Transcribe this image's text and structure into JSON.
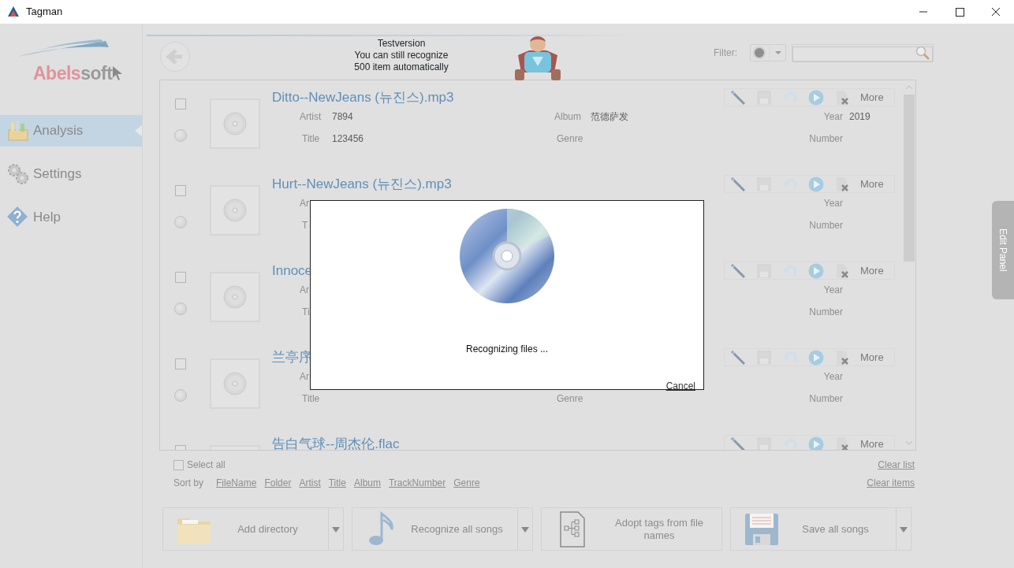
{
  "window": {
    "title": "Tagman"
  },
  "sidebar": {
    "logo": {
      "part_1": "Abels",
      "part_2": "soft"
    },
    "items": [
      {
        "label": "Analysis",
        "kind": "analysis",
        "selected": true
      },
      {
        "label": "Settings",
        "kind": "settings",
        "selected": false
      },
      {
        "label": "Help",
        "kind": "help",
        "selected": false
      }
    ]
  },
  "header": {
    "trial_lines": [
      "Testversion",
      "You can still recognize",
      "500 item automatically"
    ],
    "filter": {
      "label": "Filter:"
    }
  },
  "files": [
    {
      "title": "Ditto--NewJeans (뉴진스).mp3",
      "checked": false,
      "selected": false,
      "more": "More",
      "fields": [
        {
          "kind": "artist",
          "label": "Artist",
          "value": "7894"
        },
        {
          "kind": "album",
          "label": "Album",
          "value": "范德萨发"
        },
        {
          "kind": "year",
          "label": "Year",
          "value": "2019"
        },
        {
          "kind": "title",
          "label": "Title",
          "value": "123456"
        },
        {
          "kind": "genre",
          "label": "Genre"
        },
        {
          "kind": "number",
          "label": "Number"
        }
      ]
    },
    {
      "title": "Hurt--NewJeans (뉴진스).mp3",
      "checked": false,
      "selected": false,
      "more": "More",
      "fields": [
        {
          "kind": "artist",
          "label": "Ar"
        },
        {
          "kind": "year",
          "label": "Year"
        },
        {
          "kind": "title",
          "label": "T"
        },
        {
          "kind": "number",
          "label": "Number"
        }
      ]
    },
    {
      "title": "Innoce",
      "checked": false,
      "selected": false,
      "more": "More",
      "fields": [
        {
          "kind": "artist",
          "label": "Ar"
        },
        {
          "kind": "year",
          "label": "Year"
        },
        {
          "kind": "title",
          "label": "Ti"
        },
        {
          "kind": "number",
          "label": "Number"
        }
      ]
    },
    {
      "title": "兰亭序",
      "checked": false,
      "selected": false,
      "more": "More",
      "fields": [
        {
          "kind": "artist",
          "label": "Ar"
        },
        {
          "kind": "year",
          "label": "Year"
        },
        {
          "kind": "title",
          "label": "Title"
        },
        {
          "kind": "genre",
          "label": "Genre"
        },
        {
          "kind": "number",
          "label": "Number"
        }
      ]
    },
    {
      "title": "告白气球--周杰伦.flac",
      "checked": false,
      "more": "More"
    }
  ],
  "select_all": {
    "label": "Select all",
    "checked": false
  },
  "sort": {
    "label": "Sort by",
    "options": [
      "FileName",
      "Folder",
      "Artist",
      "Title",
      "Album",
      "TrackNumber",
      "Genre"
    ]
  },
  "clear_links": [
    "Clear list",
    "Clear items"
  ],
  "actions": [
    {
      "label": "Add directory",
      "kind": "folder",
      "dropdown": true
    },
    {
      "label": "Recognize all songs",
      "kind": "note",
      "dropdown": true
    },
    {
      "label": "Adopt tags from file names",
      "kind": "tree",
      "dropdown": false
    },
    {
      "label": "Save all songs",
      "kind": "floppy",
      "dropdown": true
    }
  ],
  "edit_panel": {
    "label": "Edit Panel"
  },
  "dialog": {
    "message": "Recognizing files ...",
    "cancel": "Cancel"
  }
}
